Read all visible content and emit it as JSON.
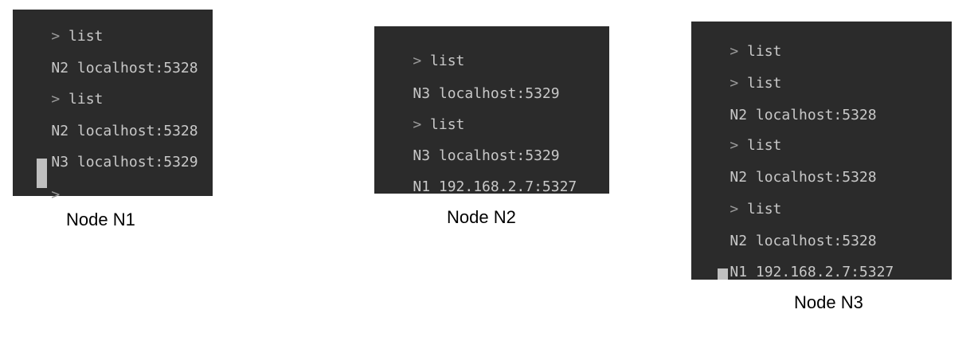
{
  "nodes": [
    {
      "caption": "Node N1",
      "lines": [
        {
          "prompt": ">",
          "text": "list"
        },
        {
          "prompt": "",
          "text": "N2 localhost:5328"
        },
        {
          "prompt": ">",
          "text": "list"
        },
        {
          "prompt": "",
          "text": "N2 localhost:5328"
        },
        {
          "prompt": "",
          "text": "N3 localhost:5329"
        },
        {
          "prompt": ">",
          "text": ""
        }
      ]
    },
    {
      "caption": "Node N2",
      "lines": [
        {
          "prompt": ">",
          "text": "list"
        },
        {
          "prompt": "",
          "text": "N3 localhost:5329"
        },
        {
          "prompt": ">",
          "text": "list"
        },
        {
          "prompt": "",
          "text": "N3 localhost:5329"
        },
        {
          "prompt": "",
          "text": "N1 192.168.2.7:5327"
        }
      ]
    },
    {
      "caption": "Node N3",
      "lines": [
        {
          "prompt": ">",
          "text": "list"
        },
        {
          "prompt": ">",
          "text": "list"
        },
        {
          "prompt": "",
          "text": "N2 localhost:5328"
        },
        {
          "prompt": ">",
          "text": "list"
        },
        {
          "prompt": "",
          "text": "N2 localhost:5328"
        },
        {
          "prompt": ">",
          "text": "list"
        },
        {
          "prompt": "",
          "text": "N2 localhost:5328"
        },
        {
          "prompt": "",
          "text": "N1 192.168.2.7:5327"
        }
      ]
    }
  ]
}
